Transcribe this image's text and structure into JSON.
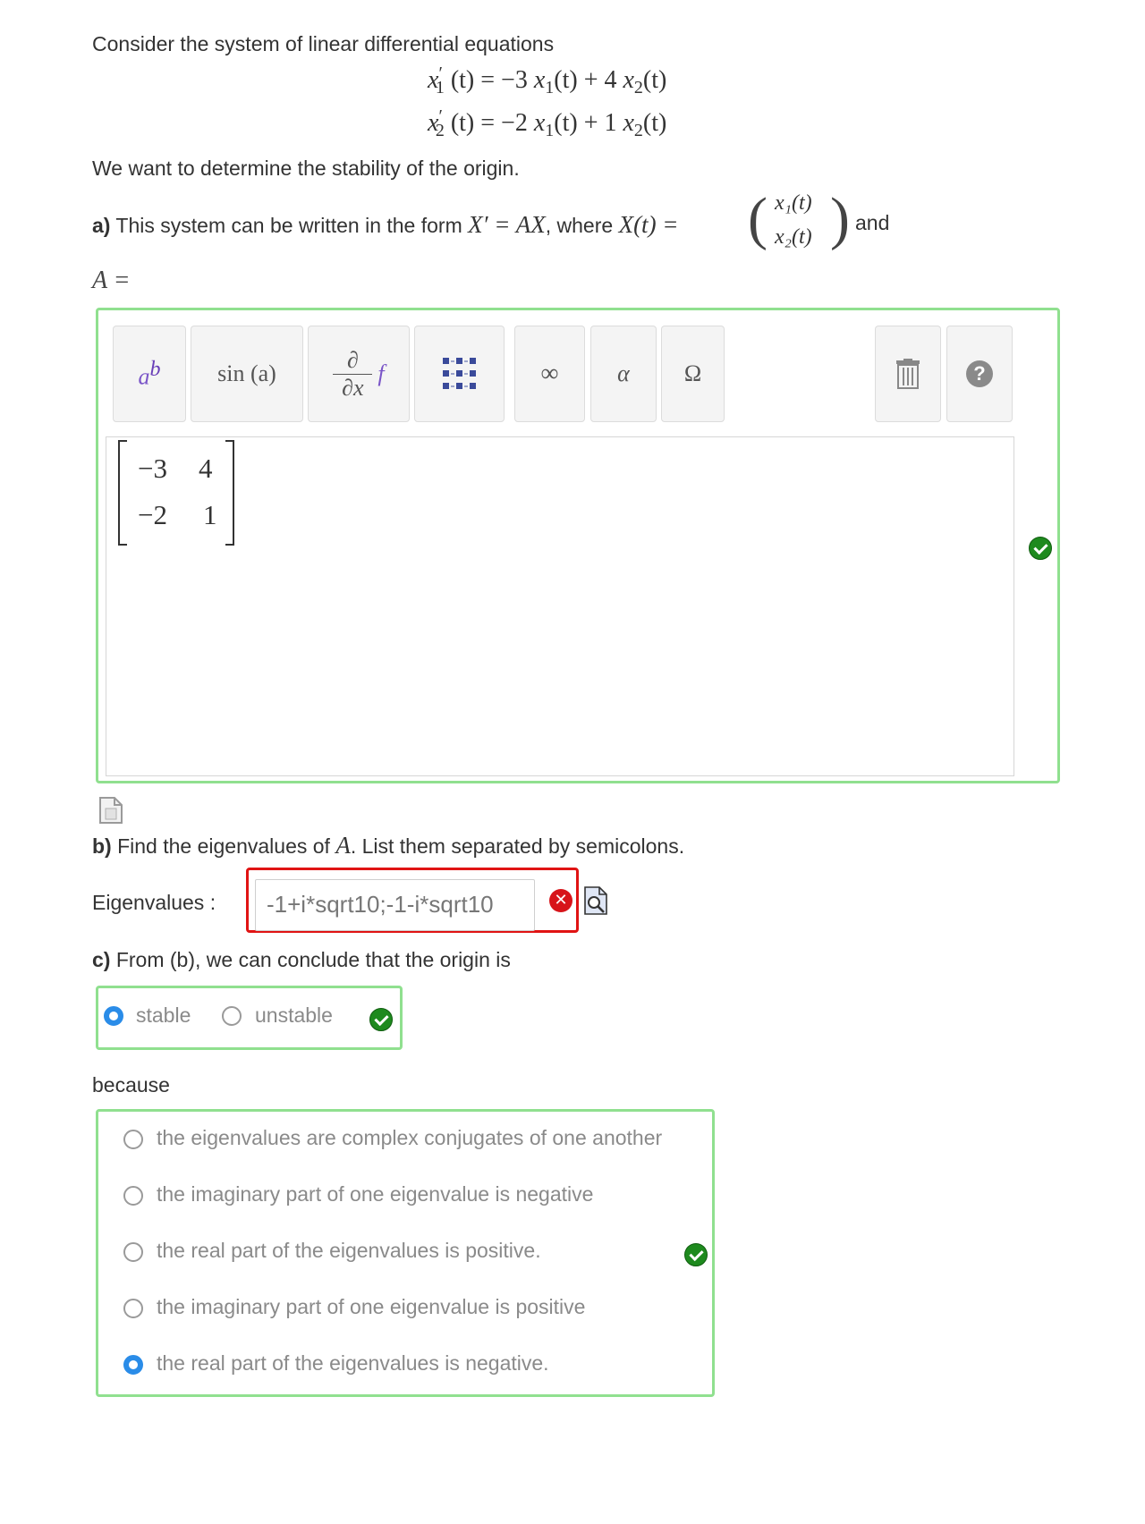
{
  "intro": "Consider the system of linear differential equations",
  "equations": {
    "eq1": {
      "lhs_var": "x",
      "lhs_sub": "1",
      "lhs_rest": "(t) = −3 ",
      "x1": "x",
      "x1_sub": "1",
      "mid": "(t) + 4 ",
      "x2": "x",
      "x2_sub": "2",
      "end": "(t)"
    },
    "eq2": {
      "lhs_var": "x",
      "lhs_sub": "2",
      "lhs_rest": "(t) = −2 ",
      "x1": "x",
      "x1_sub": "1",
      "mid": "(t) + 1 ",
      "x2": "x",
      "x2_sub": "2",
      "end": "(t)"
    }
  },
  "stability_text": "We want to determine the stability of the origin.",
  "part_a": {
    "label": "a)",
    "text": " This system can be written in the form ",
    "form": "X′ = AX",
    "where": ", where ",
    "xt": "X(t) =",
    "vec_top": "x₁(t)",
    "vec_bottom": "x₂(t)",
    "and": "and",
    "a_eq": "A ="
  },
  "toolbar": {
    "power": "a",
    "power_sup": "b",
    "sin": "sin (a)",
    "deriv_top": "∂",
    "deriv_bottom": "∂x",
    "deriv_f": "f",
    "infinity": "∞",
    "alpha": "α",
    "omega": "Ω",
    "help": "?"
  },
  "matrix": {
    "r1c1": "−3",
    "r1c2": "4",
    "r2c1": "−2",
    "r2c2": "1"
  },
  "part_b": {
    "label": "b)",
    "text_before": " Find the eigenvalues of ",
    "var": "A",
    "text_after": ". List them separated by semicolons.",
    "eig_label": "Eigenvalues :",
    "eig_value": "-1+i*sqrt10;-1-i*sqrt10"
  },
  "part_c": {
    "label": "c)",
    "text": " From (b), we can conclude that the origin is",
    "options": [
      "stable",
      "unstable"
    ],
    "selected": "stable",
    "because": "because",
    "reasons": [
      "the eigenvalues are complex conjugates of one another",
      "the imaginary part of one eigenvalue is negative",
      "the real part of the eigenvalues is positive.",
      "the imaginary part of one eigenvalue is positive",
      "the real part of the eigenvalues is negative."
    ],
    "selected_reason": "the real part of the eigenvalues is negative."
  },
  "colors": {
    "correct_border": "#90e08f",
    "incorrect_border": "#e01313",
    "radio_selected": "#2a8ce8",
    "check_green": "#1e8a1e"
  }
}
